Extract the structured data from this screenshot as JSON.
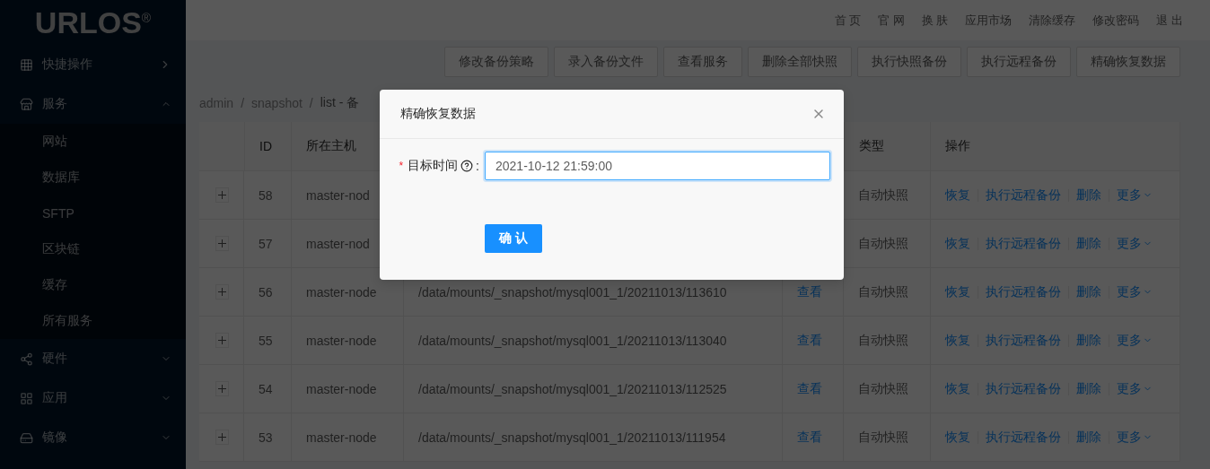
{
  "sidebar": {
    "logo": "URLOS$^{®}$",
    "items": [
      {
        "label": "快捷操作",
        "kind": "link"
      },
      {
        "label": "服务",
        "kind": "submenu",
        "expanded": true,
        "children": [
          {
            "label": "网站"
          },
          {
            "label": "数据库"
          },
          {
            "label": "SFTP"
          },
          {
            "label": "区块链"
          },
          {
            "label": "缓存"
          },
          {
            "label": "所有服务"
          }
        ]
      },
      {
        "label": "硬件",
        "kind": "submenu",
        "expanded": false
      },
      {
        "label": "应用",
        "kind": "submenu",
        "expanded": false
      },
      {
        "label": "镜像",
        "kind": "submenu",
        "expanded": false
      }
    ]
  },
  "header": {
    "links": [
      "首 页",
      "官 网",
      "换 肤",
      "应用市场",
      "清除缓存",
      "修改密码",
      "退 出"
    ]
  },
  "toolbar": {
    "buttons": [
      "修改备份策略",
      "录入备份文件",
      "查看服务",
      "删除全部快照",
      "执行快照备份",
      "执行远程备份",
      "精确恢复数据"
    ]
  },
  "breadcrumb": {
    "separator": "/",
    "items": [
      "admin",
      "snapshot",
      "list - 备"
    ]
  },
  "table": {
    "columns": [
      "ID",
      "所在主机",
      "类型",
      "操作"
    ],
    "rows": [
      {
        "id": "58",
        "host": "master-nod",
        "type": "自动快照",
        "actions": [
          "恢复",
          "执行远程备份",
          "删除",
          "更多"
        ]
      },
      {
        "id": "57",
        "host": "master-nod",
        "type": "自动快照",
        "actions": [
          "恢复",
          "执行远程备份",
          "删除",
          "更多"
        ]
      },
      {
        "id": "56",
        "host": "master-node",
        "path": "/data/mounts/_snapshot/mysql001_1/20211013/113610",
        "view": "查看",
        "type": "自动快照",
        "actions": [
          "恢复",
          "执行远程备份",
          "删除",
          "更多"
        ]
      },
      {
        "id": "55",
        "host": "master-node",
        "path": "/data/mounts/_snapshot/mysql001_1/20211013/113040",
        "view": "查看",
        "type": "自动快照",
        "actions": [
          "恢复",
          "执行远程备份",
          "删除",
          "更多"
        ]
      },
      {
        "id": "54",
        "host": "master-node",
        "path": "/data/mounts/_snapshot/mysql001_1/20211013/112525",
        "view": "查看",
        "type": "自动快照",
        "actions": [
          "恢复",
          "执行远程备份",
          "删除",
          "更多"
        ]
      },
      {
        "id": "53",
        "host": "master-node",
        "path": "/data/mounts/_snapshot/mysql001_1/20211013/111954",
        "view": "查看",
        "type": "自动快照",
        "actions": [
          "恢复",
          "执行远程备份",
          "删除",
          "更多"
        ]
      }
    ]
  },
  "modal": {
    "title": "精确恢复数据",
    "field": {
      "label": "目标时间",
      "required_mark": "*",
      "colon": ":",
      "value": "2021-10-12 21:59:00"
    },
    "submit": "确 认"
  }
}
